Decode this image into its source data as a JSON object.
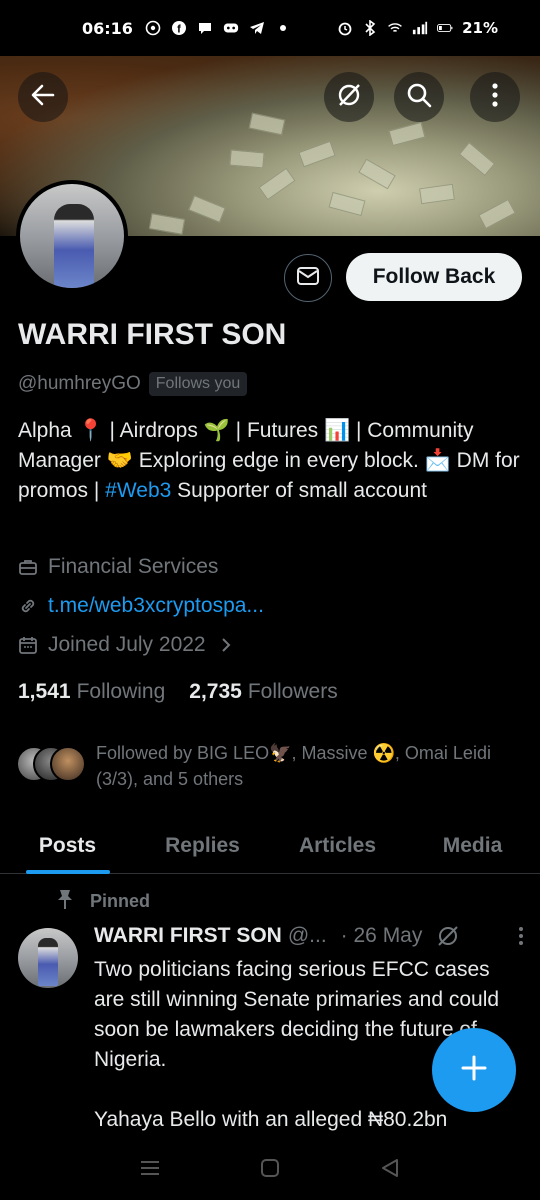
{
  "status_bar": {
    "time": "06:16",
    "battery": "21%",
    "left_icons": [
      "whatsapp-icon",
      "facebook-icon",
      "chat-icon",
      "discord-icon",
      "telegram-icon",
      "dot-icon"
    ],
    "right_icons": [
      "alarm-icon",
      "bluetooth-icon",
      "wifi-icon",
      "signal-icon",
      "battery-icon"
    ]
  },
  "header": {
    "back_icon": "arrow-left-icon",
    "grok_icon": "grok-icon",
    "search_icon": "search-icon",
    "more_icon": "more-vertical-icon"
  },
  "profile": {
    "name": "WARRI FIRST SON",
    "handle": "@humhreyGO",
    "follows_you": "Follows you",
    "follow_button": "Follow Back",
    "bio_part1": "Alpha 📍 | Airdrops 🌱 | Futures 📊 | Community Manager 🤝 Exploring edge in every block. 📩 DM for promos | ",
    "bio_hashtag": "#Web3",
    "bio_part2": "  Supporter of small account",
    "category": "Financial Services",
    "link": "t.me/web3xcryptospa...",
    "joined": "Joined July 2022",
    "following_count": "1,541",
    "following_label": "Following",
    "followers_count": "2,735",
    "followers_label": "Followers",
    "followed_by": "Followed by BIG LEO🦅, Massive ☢️, Omai Leidi (3/3), and 5 others"
  },
  "tabs": [
    {
      "label": "Posts",
      "active": true
    },
    {
      "label": "Replies",
      "active": false
    },
    {
      "label": "Articles",
      "active": false
    },
    {
      "label": "Media",
      "active": false
    }
  ],
  "post": {
    "pinned_label": "Pinned",
    "author_name": "WARRI FIRST SON",
    "author_handle": "@...",
    "date": "· 26 May",
    "text": "Two politicians facing serious EFCC cases are still winning Senate primaries and could soon be lawmakers deciding the future of Nigeria.\n\nYahaya Bello with an alleged ₦80.2bn"
  },
  "colors": {
    "accent": "#1d9bf0",
    "background": "#000000",
    "text_primary": "#e7e9ea",
    "text_secondary": "#71767b"
  }
}
